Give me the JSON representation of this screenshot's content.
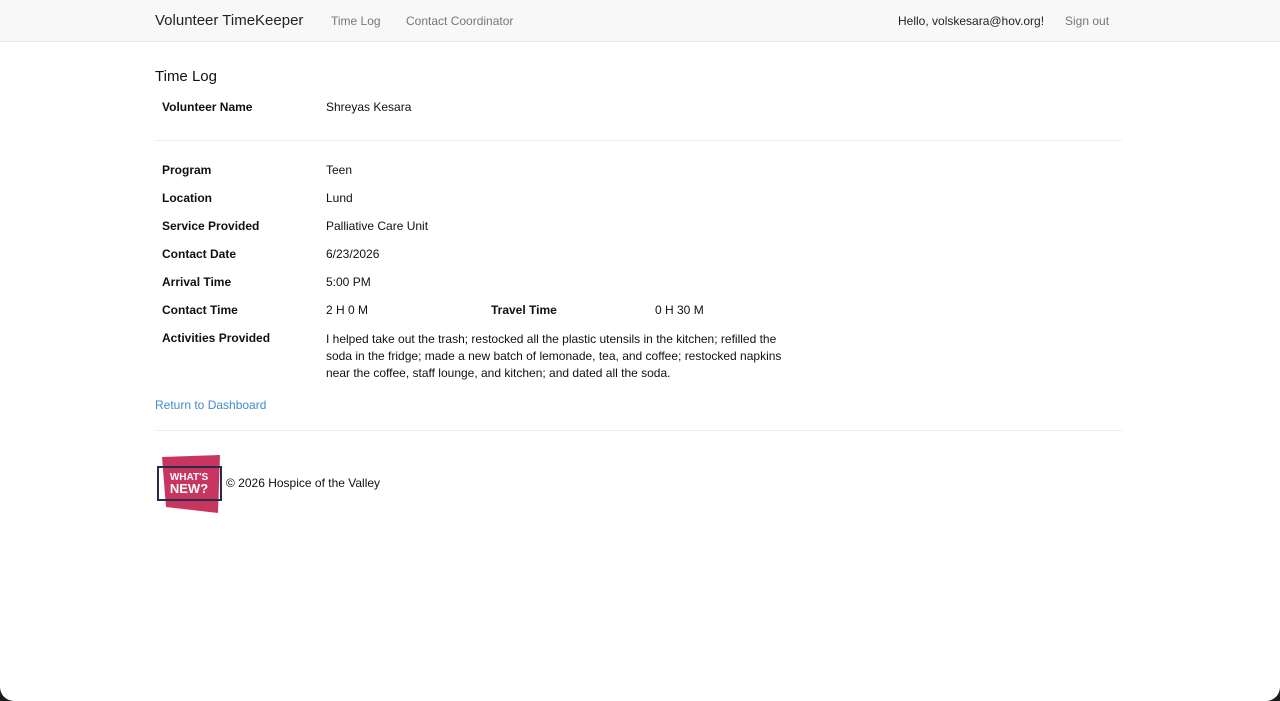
{
  "nav": {
    "brand": "Volunteer TimeKeeper",
    "links": [
      "Time Log",
      "Contact Coordinator"
    ],
    "greeting": "Hello, volskesara@hov.org!",
    "signout": "Sign out"
  },
  "page": {
    "title": "Time Log"
  },
  "volunteer": {
    "label": "Volunteer Name",
    "value": "Shreyas Kesara"
  },
  "details": {
    "program": {
      "label": "Program",
      "value": "Teen"
    },
    "location": {
      "label": "Location",
      "value": "Lund"
    },
    "service": {
      "label": "Service Provided",
      "value": "Palliative Care Unit"
    },
    "contact_date": {
      "label": "Contact Date",
      "value": "6/23/2026"
    },
    "arrival_time": {
      "label": "Arrival Time",
      "value": "5:00 PM"
    },
    "contact_time": {
      "label": "Contact Time",
      "value": "2 H 0 M"
    },
    "travel_time": {
      "label": "Travel Time",
      "value": "0 H 30 M"
    },
    "activities": {
      "label": "Activities Provided",
      "value": "I helped take out the trash; restocked all the plastic utensils in the kitchen; refilled the soda in the fridge; made a new batch of lemonade, tea, and coffee; restocked napkins near the coffee, staff lounge, and kitchen; and dated all the soda."
    }
  },
  "return_link": "Return to Dashboard",
  "footer": {
    "logo_text": [
      "WHAT'S",
      "NEW?"
    ],
    "copyright": "© 2026 Hospice of the Valley"
  },
  "colors": {
    "link": "#428bca",
    "logo_magenta": "#c8365f",
    "logo_frame": "#2b2a4c"
  }
}
